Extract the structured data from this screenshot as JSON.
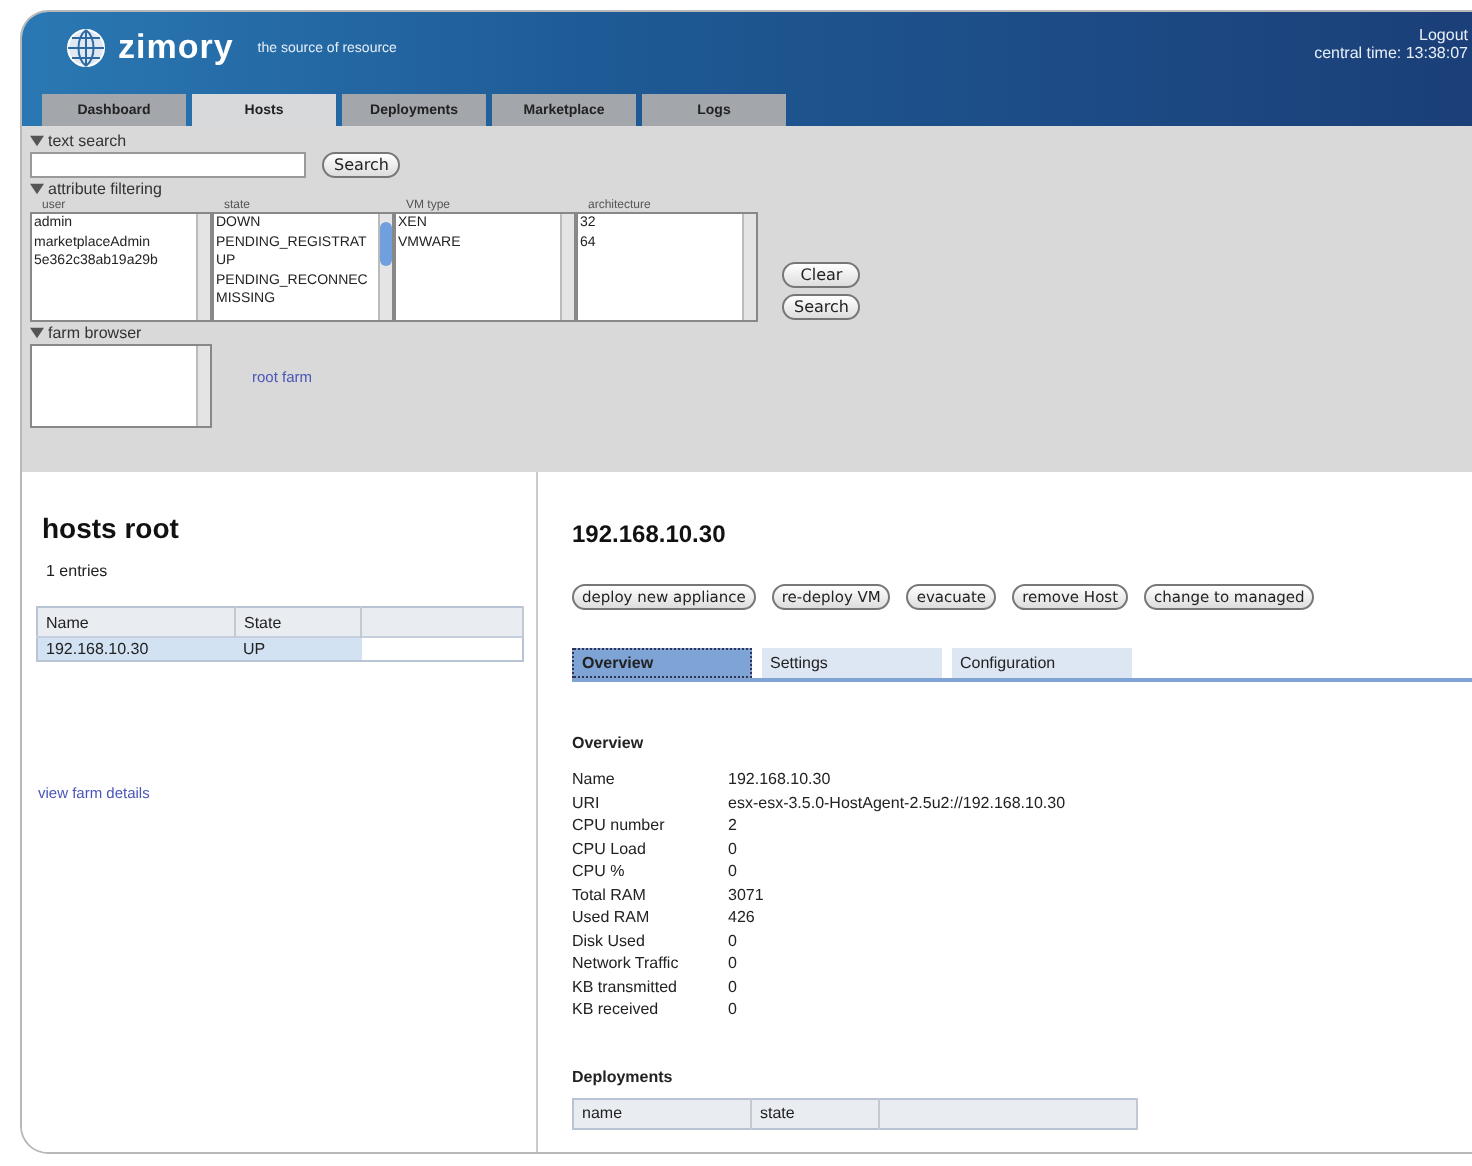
{
  "header": {
    "logo": "zimory",
    "tagline": "the source of resource",
    "logout": "Logout",
    "time": "central time: 13:38:07"
  },
  "tabs": [
    {
      "label": "Dashboard",
      "selected": false
    },
    {
      "label": "Hosts",
      "selected": true
    },
    {
      "label": "Deployments",
      "selected": false
    },
    {
      "label": "Marketplace",
      "selected": false
    },
    {
      "label": "Logs",
      "selected": false
    }
  ],
  "text_search": {
    "title": "text search",
    "expanded": true,
    "button": "Search"
  },
  "attribute_filtering": {
    "title": "attribute filtering",
    "expanded": true,
    "lists": [
      {
        "label": "user",
        "items": [
          "admin",
          "marketplaceAdmin",
          "5e362c38ab19a29b"
        ],
        "scroll": false
      },
      {
        "label": "state",
        "items": [
          "DOWN",
          "PENDING_REGISTRAT",
          "UP",
          "PENDING_RECONNEC",
          "MISSING"
        ],
        "scroll": true
      },
      {
        "label": "VM type",
        "items": [
          "XEN",
          "VMWARE"
        ],
        "scroll": false
      },
      {
        "label": "architecture",
        "items": [
          "32",
          "64"
        ],
        "scroll": false
      }
    ],
    "buttons": [
      "Clear",
      "Search"
    ]
  },
  "farm_browser": {
    "title": "farm browser",
    "expanded": true,
    "link": "root farm"
  },
  "left": {
    "title": "hosts root",
    "count": "1 entries",
    "columns": [
      "Name",
      "State"
    ],
    "rows": [
      {
        "cells": [
          "192.168.10.30",
          "UP"
        ],
        "selected": true
      }
    ],
    "link": "view farm details"
  },
  "detail": {
    "title": "192.168.10.30",
    "actions": [
      "deploy new appliance",
      "re-deploy VM",
      "evacuate",
      "remove Host",
      "change to managed"
    ],
    "tabs": [
      {
        "label": "Overview",
        "selected": true
      },
      {
        "label": "Settings",
        "selected": false
      },
      {
        "label": "Configuration",
        "selected": false
      }
    ],
    "overview_title": "Overview",
    "properties": [
      {
        "label": "Name",
        "value": "192.168.10.30"
      },
      {
        "label": "URI",
        "value": "esx-esx-3.5.0-HostAgent-2.5u2://192.168.10.30"
      },
      {
        "label": "CPU number",
        "value": "2"
      },
      {
        "label": "CPU Load",
        "value": "0"
      },
      {
        "label": "CPU %",
        "value": "0"
      },
      {
        "label": "Total RAM",
        "value": "3071"
      },
      {
        "label": "Used RAM",
        "value": "426"
      },
      {
        "label": "Disk Used",
        "value": "0"
      },
      {
        "label": "Network Traffic",
        "value": "0"
      },
      {
        "label": "KB transmitted",
        "value": "0"
      },
      {
        "label": "KB received",
        "value": "0"
      }
    ],
    "deployments_title": "Deployments",
    "deployment_columns": [
      "name",
      "state"
    ]
  }
}
